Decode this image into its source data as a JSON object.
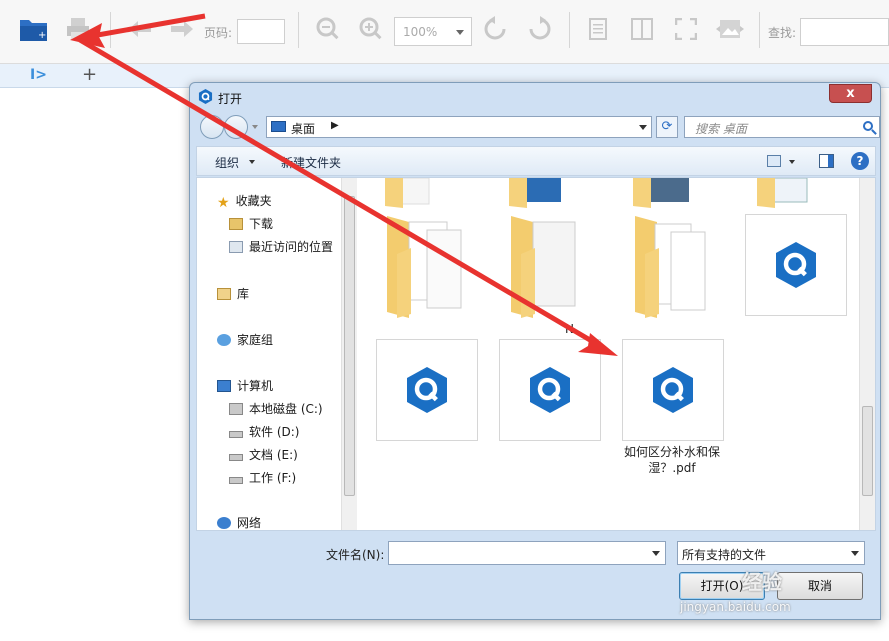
{
  "toolbar": {
    "page_label": "页码:",
    "zoom_value": "100%",
    "find_label": "查找:"
  },
  "dialog": {
    "title": "打开",
    "close_symbol": "x",
    "address": "桌面",
    "search_placeholder": "搜索 桌面",
    "commands": {
      "organize": "组织",
      "new_folder": "新建文件夹"
    },
    "nav": {
      "favorites": "收藏夹",
      "downloads": "下载",
      "recent": "最近访问的位置",
      "libraries": "库",
      "homegroup": "家庭组",
      "computer": "计算机",
      "drive_c": "本地磁盘 (C:)",
      "drive_d": "软件 (D:)",
      "drive_e": "文档 (E:)",
      "drive_f": "工作 (F:)",
      "network": "网络"
    },
    "files": {
      "selected_pdf_name": "如何区分补水和保湿？.pdf",
      "folder_partial_label": "N"
    },
    "footer": {
      "filename_label": "文件名(N):",
      "filename_value": "",
      "filter_value": "所有支持的文件",
      "open_button": "打开(O)",
      "cancel_button": "取消"
    }
  },
  "watermark": {
    "brand": "经验",
    "url": "jingyan.baidu.com"
  },
  "colors": {
    "accent": "#2d6fc4",
    "arrow": "#e8332f",
    "dialog_frame": "#cfe0f3",
    "q_logo": "#1a6fc4"
  }
}
